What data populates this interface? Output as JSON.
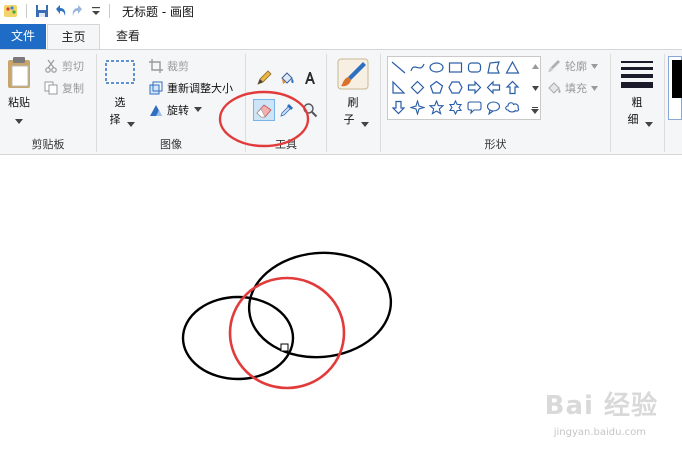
{
  "window": {
    "title": "无标题 - 画图"
  },
  "tabs": [
    {
      "label": "文件"
    },
    {
      "label": "主页"
    },
    {
      "label": "查看"
    }
  ],
  "clipboard": {
    "paste_label": "粘贴",
    "cut_label": "剪切",
    "copy_label": "复制",
    "group_label": "剪贴板"
  },
  "image": {
    "select_label_1": "选",
    "select_label_2": "择",
    "crop_label": "裁剪",
    "resize_label": "重新调整大小",
    "rotate_label": "旋转",
    "group_label": "图像"
  },
  "tools": {
    "group_label": "工具",
    "items": [
      "pencil-icon",
      "fill-icon",
      "text-icon",
      "eraser-icon",
      "color-picker-icon",
      "magnifier-icon"
    ],
    "selected": "eraser-icon"
  },
  "brushes": {
    "label_1": "刷",
    "label_2": "子"
  },
  "shapes": {
    "group_label": "形状",
    "outline_label": "轮廓",
    "fill_label": "填充"
  },
  "size": {
    "label_1": "粗",
    "label_2": "细"
  },
  "colors": {
    "accent": "#1e6cc6",
    "highlight_circle": "#e23b3b",
    "drawing_black": "#000000",
    "drawing_red": "#e23b3b"
  },
  "watermark": {
    "text": "Bai 经验",
    "sub": "jingyan.baidu.com"
  }
}
